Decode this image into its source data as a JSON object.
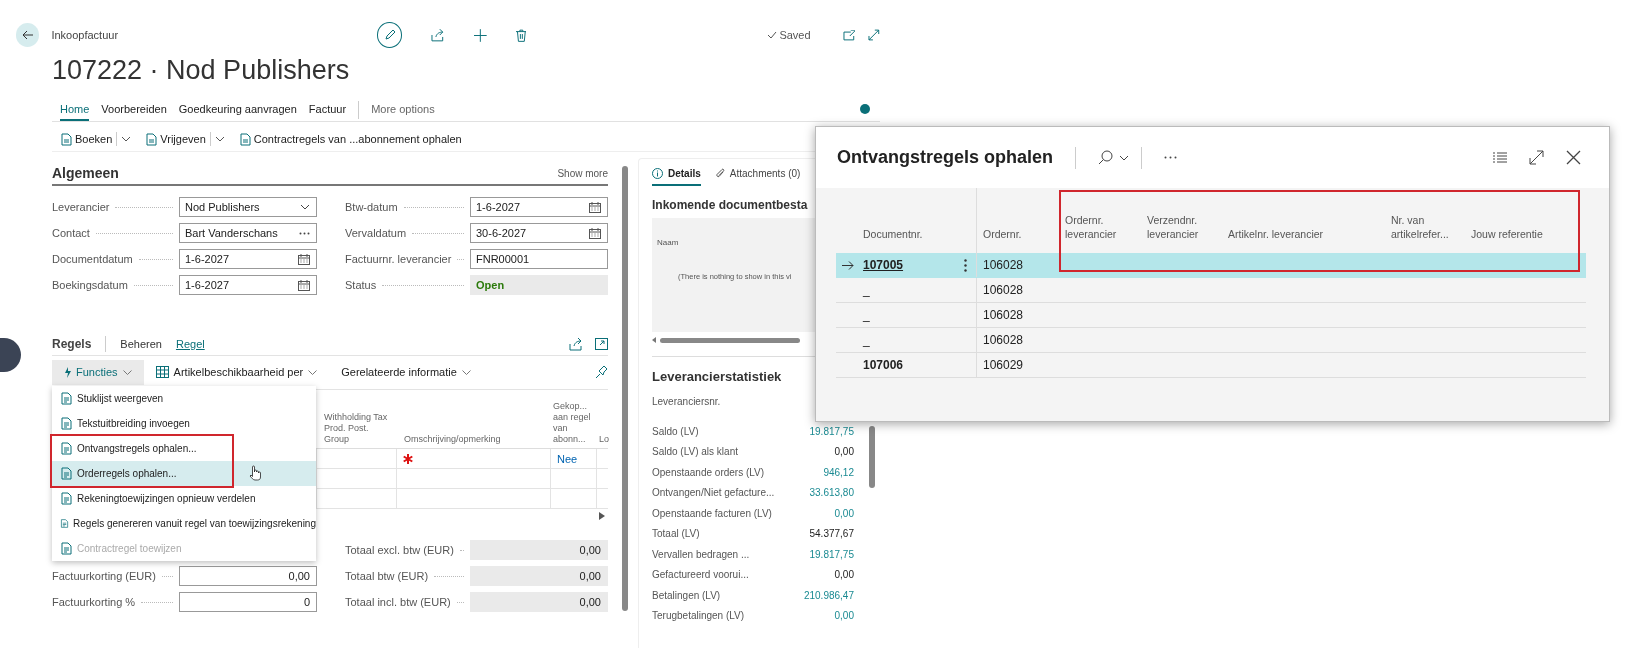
{
  "header": {
    "breadcrumb": "Inkoopfactuur",
    "title": "107222 · Nod Publishers",
    "save_status": "Saved"
  },
  "nav_tabs": [
    {
      "label": "Home",
      "selected": true,
      "kind": "tab"
    },
    {
      "label": "Voorbereiden",
      "selected": false,
      "kind": "tab"
    },
    {
      "label": "Goedkeuring aanvragen",
      "selected": false,
      "kind": "tab"
    },
    {
      "label": "Factuur",
      "selected": false,
      "kind": "tab"
    },
    {
      "label": "More options",
      "selected": false,
      "kind": "more"
    }
  ],
  "actions": [
    {
      "label": "Boeken",
      "has_dropdown": true
    },
    {
      "label": "Vrijgeven",
      "has_dropdown": true
    },
    {
      "label": "Contractregels van ...abonnement ophalen",
      "has_dropdown": false
    }
  ],
  "general": {
    "title": "Algemeen",
    "show_more": "Show more",
    "left_fields": [
      {
        "label": "Leverancier",
        "value": "Nod Publishers",
        "kind": "dropdown"
      },
      {
        "label": "Contact",
        "value": "Bart Vanderschans",
        "kind": "lookup"
      },
      {
        "label": "Documentdatum",
        "value": "1-6-2027",
        "kind": "date"
      },
      {
        "label": "Boekingsdatum",
        "value": "1-6-2027",
        "kind": "date"
      }
    ],
    "right_fields": [
      {
        "label": "Btw-datum",
        "value": "1-6-2027",
        "kind": "date"
      },
      {
        "label": "Vervaldatum",
        "value": "30-6-2027",
        "kind": "date"
      },
      {
        "label": "Factuurnr. leverancier",
        "value": "FNR00001",
        "kind": "text"
      },
      {
        "label": "Status",
        "value": "Open",
        "kind": "status"
      }
    ]
  },
  "lines": {
    "title": "Regels",
    "tabs": [
      {
        "label": "Beheren",
        "selected": false
      },
      {
        "label": "Regel",
        "selected": true
      }
    ],
    "toolbar": [
      {
        "label": "Functies",
        "expanded": true
      },
      {
        "label": "Artikelbeschikbaarheid per",
        "expanded": false
      },
      {
        "label": "Gerelateerde informatie",
        "expanded": false
      }
    ],
    "menu": [
      {
        "label": "Stuklijst weergeven",
        "disabled": false,
        "highlighted": false,
        "marked": false
      },
      {
        "label": "Tekstuitbreiding invoegen",
        "disabled": false,
        "highlighted": false,
        "marked": false
      },
      {
        "label": "Ontvangstregels ophalen...",
        "disabled": false,
        "highlighted": false,
        "marked": true
      },
      {
        "label": "Orderregels ophalen...",
        "disabled": false,
        "highlighted": true,
        "marked": true
      },
      {
        "label": "Rekeningtoewijzingen opnieuw verdelen",
        "disabled": false,
        "highlighted": false,
        "marked": false
      },
      {
        "label": "Regels genereren vanuit regel van toewijzingsrekening",
        "disabled": false,
        "highlighted": false,
        "marked": false
      },
      {
        "label": "Contractregel toewijzen",
        "disabled": true,
        "highlighted": false,
        "marked": false
      }
    ],
    "columns": [
      "Withholding Tax Prod. Post. Group",
      "Omschrijving/opmerking",
      "Gekop... aan regel van abonn...",
      "Lo"
    ],
    "rows": [
      {
        "description_required": true,
        "subscription_link": "Nee"
      },
      {
        "description_required": false
      },
      {
        "description_required": false
      }
    ]
  },
  "totals": {
    "left": [
      {
        "label": "Factuurkorting (EUR)",
        "value": "0,00"
      },
      {
        "label": "Factuurkorting %",
        "value": "0"
      }
    ],
    "right": [
      {
        "label": "Totaal excl. btw (EUR)",
        "value": "0,00"
      },
      {
        "label": "Totaal btw (EUR)",
        "value": "0,00"
      },
      {
        "label": "Totaal incl. btw (EUR)",
        "value": "0,00"
      }
    ]
  },
  "factbox": {
    "tabs": [
      {
        "label": "Details",
        "selected": true
      },
      {
        "label": "Attachments (0)",
        "selected": false
      }
    ],
    "documents": {
      "title": "Inkomende documentbesta",
      "column": "Naam",
      "empty_text": "(There is nothing to show in this vi"
    },
    "statistics": {
      "title": "Leverancierstatistiek",
      "rows": [
        {
          "label": "Leveranciersnr."
        },
        {
          "label": "Saldo (LV)",
          "value": "19.817,75",
          "link": true
        },
        {
          "label": "Saldo (LV) als klant",
          "value": "0,00",
          "link": false
        },
        {
          "label": "Openstaande orders (LV)",
          "value": "946,12",
          "link": true
        },
        {
          "label": "Ontvangen/Niet gefacture...",
          "value": "33.613,80",
          "link": true
        },
        {
          "label": "Openstaande facturen (LV)",
          "value": "0,00",
          "link": true
        },
        {
          "label": "Totaal (LV)",
          "value": "54.377,67",
          "link": false
        },
        {
          "label": "Vervallen bedragen ...",
          "value": "19.817,75",
          "link": true
        },
        {
          "label": "Gefactureerd voorui...",
          "value": "0,00",
          "link": false
        },
        {
          "label": "Betalingen (LV)",
          "value": "210.986,47",
          "link": true
        },
        {
          "label": "Terugbetalingen (LV)",
          "value": "0,00",
          "link": true
        }
      ]
    }
  },
  "dialog": {
    "title": "Ontvangstregels ophalen",
    "columns": [
      {
        "label": "Documentnr.",
        "marked": false
      },
      {
        "label": "Ordernr.",
        "marked": false
      },
      {
        "label": "Ordernr. leverancier",
        "marked": true
      },
      {
        "label": "Verzendnr. leverancier",
        "marked": true
      },
      {
        "label": "Artikelnr. leverancier",
        "marked": true
      },
      {
        "label": "Nr. van artikelrefer...",
        "marked": true
      },
      {
        "label": "Jouw referentie",
        "marked": true
      }
    ],
    "rows": [
      {
        "document": "107005",
        "order": "106028",
        "selected": true,
        "kind": "document"
      },
      {
        "document": "_",
        "order": "106028",
        "selected": false,
        "kind": "line"
      },
      {
        "document": "_",
        "order": "106028",
        "selected": false,
        "kind": "line"
      },
      {
        "document": "_",
        "order": "106028",
        "selected": false,
        "kind": "line"
      },
      {
        "document": "107006",
        "order": "106029",
        "selected": false,
        "kind": "document"
      }
    ]
  }
}
